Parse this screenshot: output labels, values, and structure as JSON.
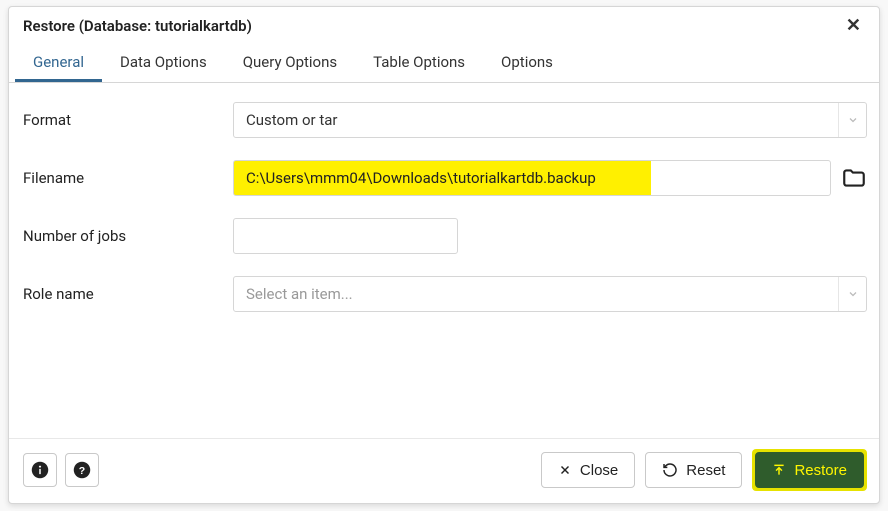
{
  "title": "Restore (Database: tutorialkartdb)",
  "tabs": {
    "general": "General",
    "data_options": "Data Options",
    "query_options": "Query Options",
    "table_options": "Table Options",
    "options": "Options"
  },
  "form": {
    "format": {
      "label": "Format",
      "value": "Custom or tar"
    },
    "filename": {
      "label": "Filename",
      "value": "C:\\Users\\mmm04\\Downloads\\tutorialkartdb.backup"
    },
    "jobs": {
      "label": "Number of jobs",
      "value": ""
    },
    "role": {
      "label": "Role name",
      "placeholder": "Select an item..."
    }
  },
  "footer": {
    "close": "Close",
    "reset": "Reset",
    "restore": "Restore"
  }
}
